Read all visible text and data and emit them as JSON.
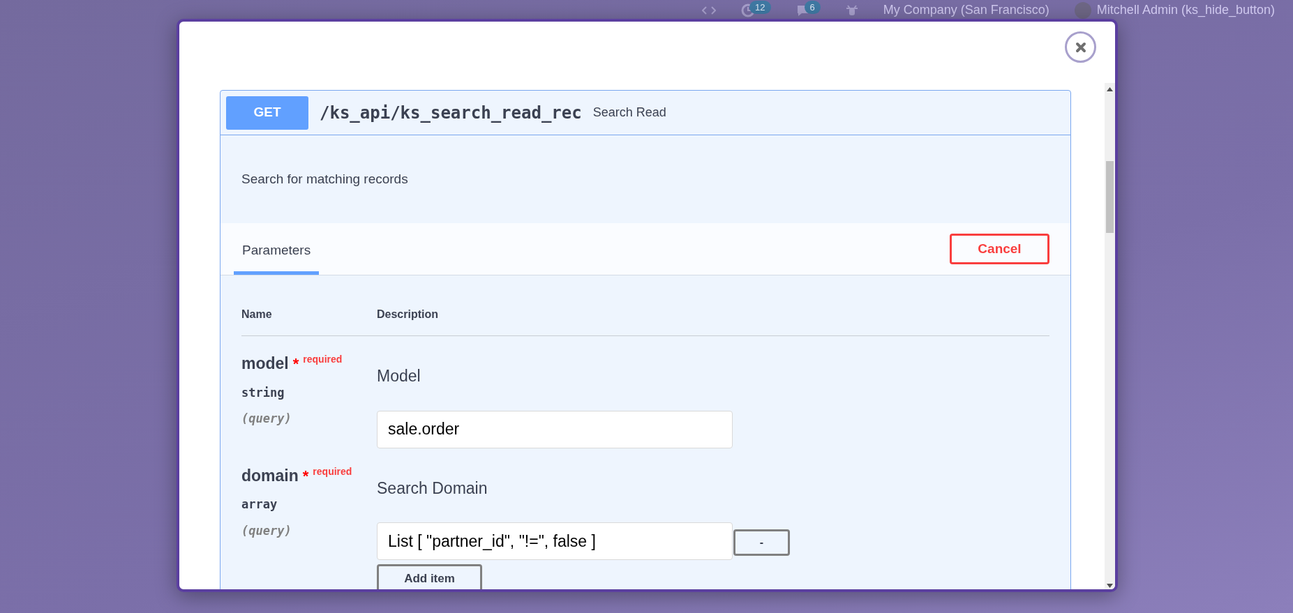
{
  "topbar": {
    "activity_badge": "12",
    "messages_badge": "6",
    "company": "My Company (San Francisco)",
    "user": "Mitchell Admin (ks_hide_button)"
  },
  "operation": {
    "method": "GET",
    "path": "/ks_api/ks_search_read_rec",
    "summary": "Search Read",
    "description": "Search for matching records",
    "tabs": [
      {
        "label": "Parameters",
        "selected": true
      }
    ],
    "cancel": "Cancel",
    "columns": [
      "Name",
      "Description"
    ],
    "parameters": [
      {
        "kind": "text",
        "name": "model",
        "required_mark": "*",
        "required_label": "required",
        "type": "string",
        "location": "(query)",
        "description": "Model",
        "value": "sale.order"
      },
      {
        "kind": "array",
        "name": "domain",
        "required_mark": "*",
        "required_label": "required",
        "type": "array",
        "location": "(query)",
        "description": "Search Domain",
        "items": [
          {
            "value": "List [ \"partner_id\", \"!=\", false ]",
            "remove": "-"
          }
        ],
        "add_label": "Add item"
      }
    ]
  }
}
